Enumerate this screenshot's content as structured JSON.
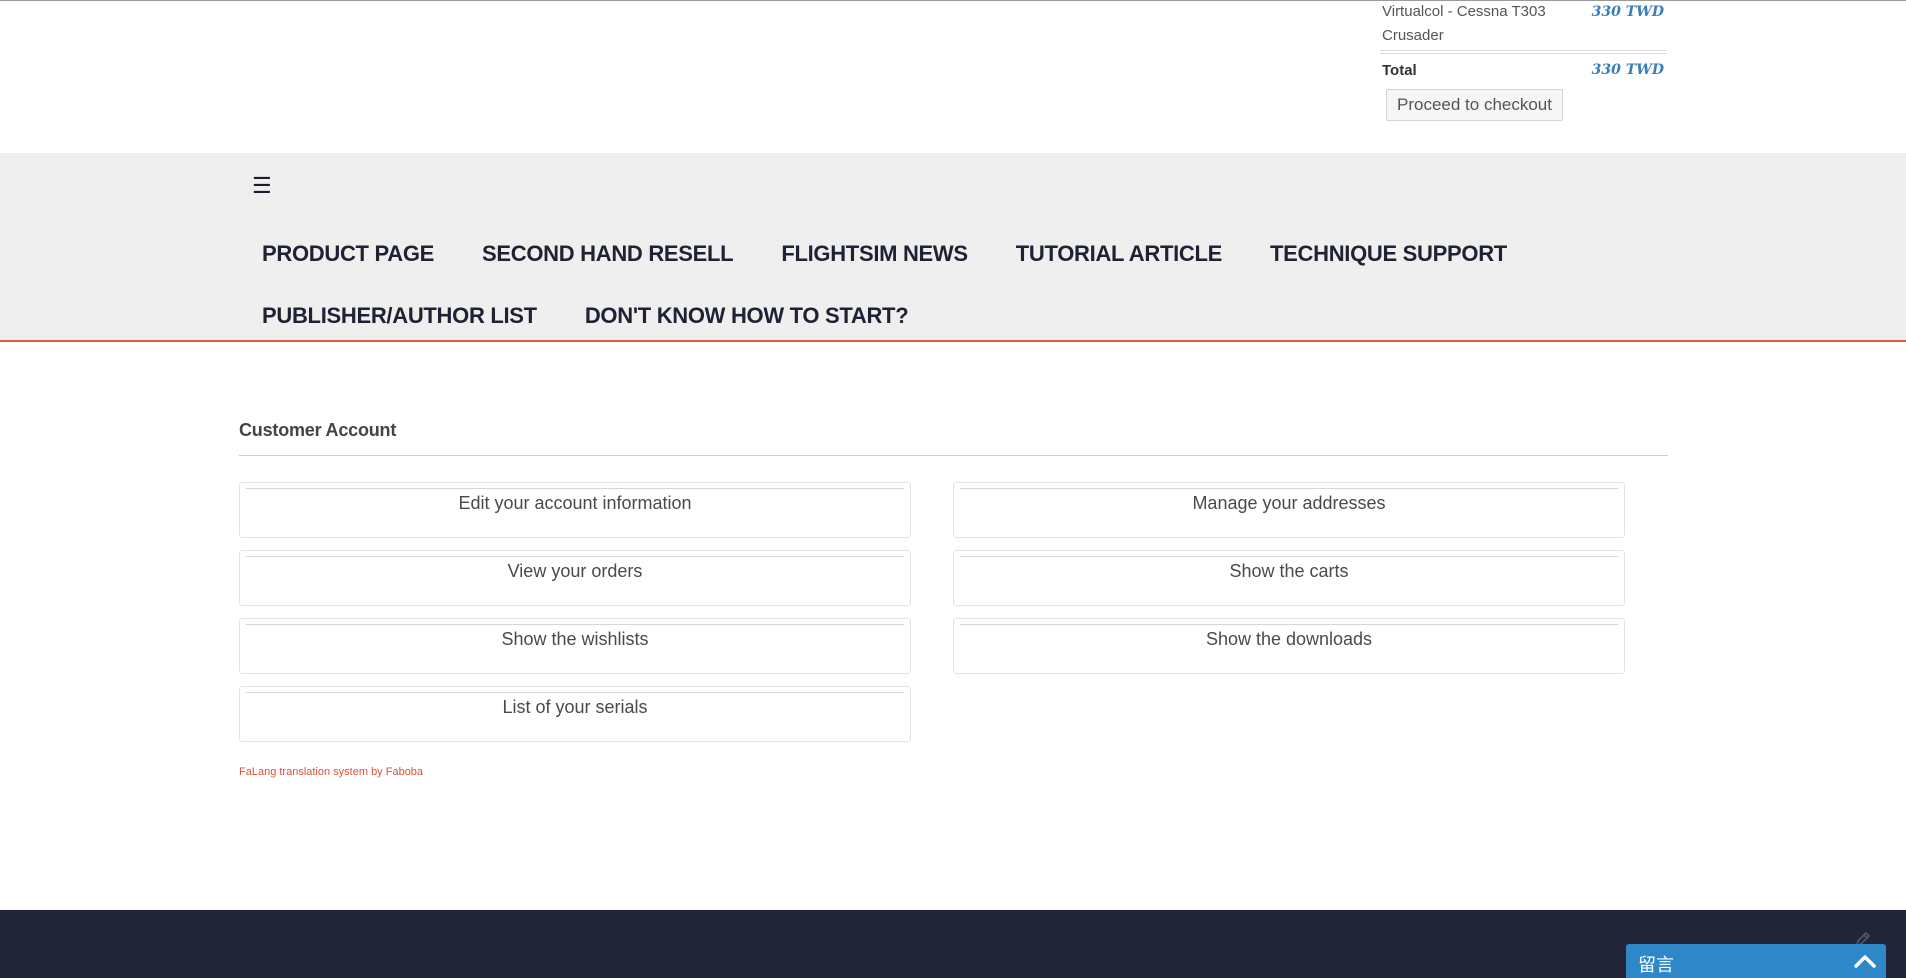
{
  "cart": {
    "item_name": "Virtualcol - Cessna T303 Crusader",
    "item_price": "330 TWD",
    "total_label": "Total",
    "total_price": "330 TWD",
    "checkout_label": "Proceed to checkout"
  },
  "nav": {
    "menu_icon": "hamburger-icon",
    "items": [
      {
        "label": "PRODUCT PAGE"
      },
      {
        "label": "SECOND HAND RESELL"
      },
      {
        "label": "FLIGHTSIM NEWS"
      },
      {
        "label": "TUTORIAL ARTICLE"
      },
      {
        "label": "TECHNIQUE SUPPORT"
      },
      {
        "label": "PUBLISHER/AUTHOR LIST"
      },
      {
        "label": "DON'T KNOW HOW TO START?"
      }
    ]
  },
  "account": {
    "title": "Customer Account",
    "tiles": [
      {
        "label": "Edit your account information"
      },
      {
        "label": "Manage your addresses"
      },
      {
        "label": "View your orders"
      },
      {
        "label": "Show the carts"
      },
      {
        "label": "Show the wishlists"
      },
      {
        "label": "Show the downloads"
      },
      {
        "label": "List of your serials"
      }
    ]
  },
  "credit": "FaLang translation system by Faboba",
  "chat": {
    "label": "留言",
    "toggle_icon": "chevron-up-icon"
  },
  "colors": {
    "accent": "#e05a3d",
    "price": "#3a7dba",
    "footer": "#222537",
    "chat": "#2e87c8"
  }
}
